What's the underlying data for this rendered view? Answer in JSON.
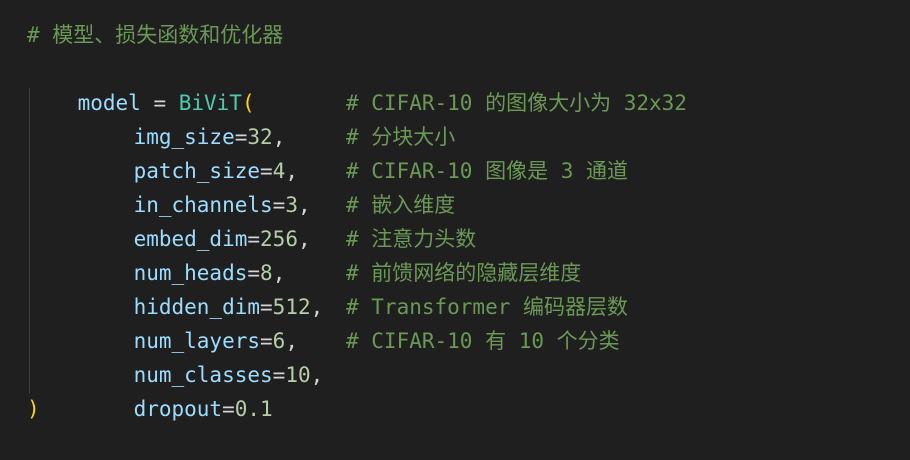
{
  "code": {
    "header_comment": "# 模型、损失函数和优化器",
    "assign": {
      "var": "model",
      "op": " = ",
      "fn": "BiViT",
      "open": "(",
      "close": ")"
    },
    "args": [
      {
        "name": "img_size",
        "eq": "=",
        "value": "32",
        "sep": ",",
        "comment": "# CIFAR-10 的图像大小为 32x32"
      },
      {
        "name": "patch_size",
        "eq": "=",
        "value": "4",
        "sep": ",",
        "comment": "# 分块大小"
      },
      {
        "name": "in_channels",
        "eq": "=",
        "value": "3",
        "sep": ",",
        "comment": "# CIFAR-10 图像是 3 通道"
      },
      {
        "name": "embed_dim",
        "eq": "=",
        "value": "256",
        "sep": ",",
        "comment": "# 嵌入维度"
      },
      {
        "name": "num_heads",
        "eq": "=",
        "value": "8",
        "sep": ",",
        "comment": "# 注意力头数"
      },
      {
        "name": "hidden_dim",
        "eq": "=",
        "value": "512",
        "sep": ",",
        "comment": "# 前馈网络的隐藏层维度"
      },
      {
        "name": "num_layers",
        "eq": "=",
        "value": "6",
        "sep": ",",
        "comment": "# Transformer 编码器层数"
      },
      {
        "name": "num_classes",
        "eq": "=",
        "value": "10",
        "sep": ",",
        "comment": "# CIFAR-10 有 10 个分类"
      },
      {
        "name": "dropout",
        "eq": "=",
        "value": "0.1",
        "sep": "",
        "comment": ""
      }
    ]
  },
  "colors": {
    "background": "#1f1f1f",
    "comment": "#6a9955",
    "variable": "#9cdcfe",
    "function": "#4ec9b0",
    "number": "#b5cea8",
    "paren": "#ffd700"
  }
}
